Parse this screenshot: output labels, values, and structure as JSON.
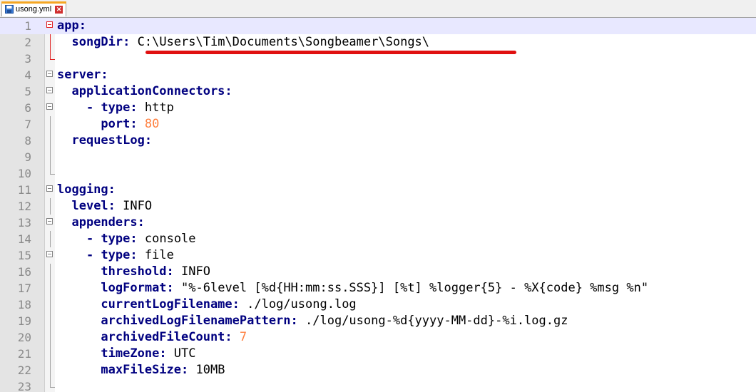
{
  "tab": {
    "filename": "usong.yml",
    "close_glyph": "✕",
    "icon": "file-save-icon"
  },
  "colors": {
    "key": "#000080",
    "number": "#ff8040",
    "annotation": "#e01010",
    "current_line": "#e8e8ff"
  },
  "lines": [
    {
      "n": "1",
      "indent": "",
      "key": "app",
      "sep": ":",
      "value": ""
    },
    {
      "n": "2",
      "indent": "  ",
      "key": "songDir",
      "sep": ":",
      "value": " C:\\Users\\Tim\\Documents\\Songbeamer\\Songs\\"
    },
    {
      "n": "3",
      "indent": "",
      "key": "",
      "sep": "",
      "value": ""
    },
    {
      "n": "4",
      "indent": "",
      "key": "server",
      "sep": ":",
      "value": ""
    },
    {
      "n": "5",
      "indent": "  ",
      "key": "applicationConnectors",
      "sep": ":",
      "value": ""
    },
    {
      "n": "6",
      "indent": "    ",
      "key": "type",
      "sep": ":",
      "value": " http",
      "dash": "- "
    },
    {
      "n": "7",
      "indent": "      ",
      "key": "port",
      "sep": ":",
      "value": "",
      "num": " 80"
    },
    {
      "n": "8",
      "indent": "  ",
      "key": "requestLog",
      "sep": ":",
      "value": ""
    },
    {
      "n": "9",
      "indent": "",
      "key": "",
      "sep": "",
      "value": ""
    },
    {
      "n": "10",
      "indent": "",
      "key": "",
      "sep": "",
      "value": ""
    },
    {
      "n": "11",
      "indent": "",
      "key": "logging",
      "sep": ":",
      "value": ""
    },
    {
      "n": "12",
      "indent": "  ",
      "key": "level",
      "sep": ":",
      "value": " INFO"
    },
    {
      "n": "13",
      "indent": "  ",
      "key": "appenders",
      "sep": ":",
      "value": ""
    },
    {
      "n": "14",
      "indent": "    ",
      "key": "type",
      "sep": ":",
      "value": " console",
      "dash": "- "
    },
    {
      "n": "15",
      "indent": "    ",
      "key": "type",
      "sep": ":",
      "value": " file",
      "dash": "- "
    },
    {
      "n": "16",
      "indent": "      ",
      "key": "threshold",
      "sep": ":",
      "value": " INFO"
    },
    {
      "n": "17",
      "indent": "      ",
      "key": "logFormat",
      "sep": ":",
      "value": " \"%-6level [%d{HH:mm:ss.SSS}] [%t] %logger{5} - %X{code} %msg %n\""
    },
    {
      "n": "18",
      "indent": "      ",
      "key": "currentLogFilename",
      "sep": ":",
      "value": " ./log/usong.log"
    },
    {
      "n": "19",
      "indent": "      ",
      "key": "archivedLogFilenamePattern",
      "sep": ":",
      "value": " ./log/usong-%d{yyyy-MM-dd}-%i.log.gz"
    },
    {
      "n": "20",
      "indent": "      ",
      "key": "archivedFileCount",
      "sep": ":",
      "value": "",
      "num": " 7"
    },
    {
      "n": "21",
      "indent": "      ",
      "key": "timeZone",
      "sep": ":",
      "value": " UTC"
    },
    {
      "n": "22",
      "indent": "      ",
      "key": "maxFileSize",
      "sep": ":",
      "value": " 10MB"
    },
    {
      "n": "23",
      "indent": "",
      "key": "",
      "sep": "",
      "value": ""
    }
  ]
}
